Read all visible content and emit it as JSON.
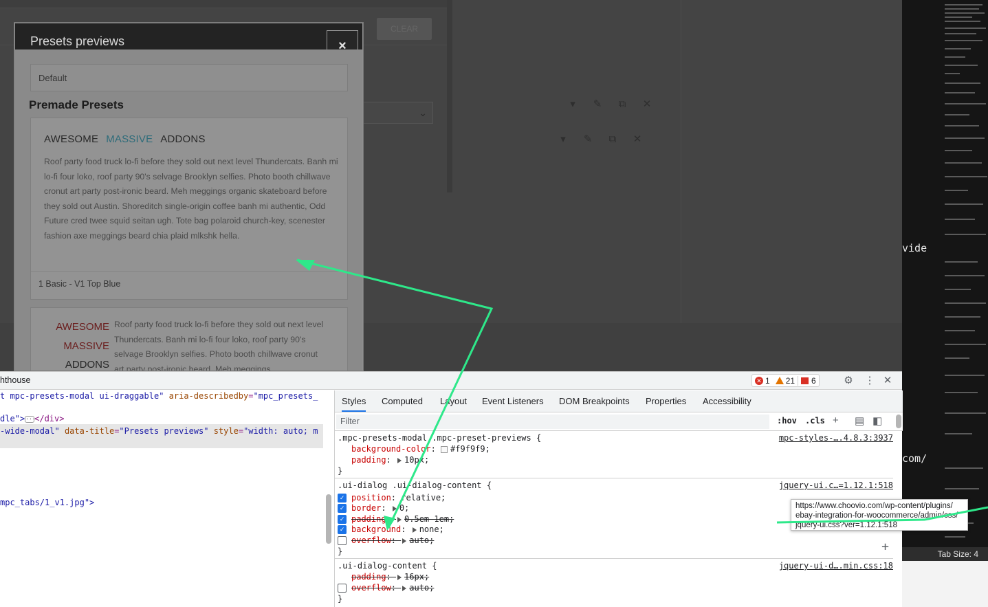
{
  "background_page": {
    "button_label": "CLEAR"
  },
  "modal": {
    "title": "Presets previews",
    "close_label": "×",
    "default_label": "Default",
    "section_title": "Premade Presets",
    "card1": {
      "brand_word1": "AWESOME",
      "brand_word2": "MASSIVE",
      "brand_word3": "ADDONS",
      "paragraph": "Roof party food truck lo-fi before they sold out next level Thundercats. Banh mi lo-fi four loko, roof party 90's selvage Brooklyn selfies. Photo booth chillwave cronut art party post-ironic beard. Meh meggings organic skateboard before they sold out Austin. Shoreditch single-origin coffee banh mi authentic, Odd Future cred twee squid seitan ugh. Tote bag polaroid church-key, scenester fashion axe meggings beard chia plaid mlkshk hella.",
      "caption": "1 Basic - V1 Top Blue"
    },
    "card2": {
      "brand_word1": "AWESOME",
      "brand_word2": "MASSIVE",
      "brand_word3": "ADDONS",
      "paragraph": "Roof party food truck lo-fi before they sold out next level Thundercats. Banh mi lo-fi four loko, roof party 90's selvage Brooklyn selfies. Photo booth chillwave cronut art party post-ironic beard. Meh meggings"
    }
  },
  "editor": {
    "text1": "vide",
    "text2": "com/",
    "status": "Tab Size: 4"
  },
  "devtools": {
    "panel_label": "hthouse",
    "errors": "1",
    "warnings": "21",
    "issues": "6",
    "elements": {
      "line1_prefix": "t mpc-presets-modal ui-draggable\"",
      "line1_attr": "aria-describedby",
      "line1_val": "\"mpc_presets_",
      "line2_prefix": "dle\">",
      "line2_suffix": "</div>",
      "line3_prefix": "-wide-modal\"",
      "line3_attr1": "data-title",
      "line3_val1": "\"Presets previews\"",
      "line3_attr2": "style",
      "line3_val2": "\"width: auto; m",
      "line4": "mpc_tabs/1_v1.jpg\">"
    },
    "tabs": [
      "Styles",
      "Computed",
      "Layout",
      "Event Listeners",
      "DOM Breakpoints",
      "Properties",
      "Accessibility"
    ],
    "filter_placeholder": "Filter",
    "hov": ":hov",
    "cls": ".cls",
    "rules": [
      {
        "selector": ".mpc-presets-modal .mpc-preset-previews {",
        "source": "mpc-styles-….4.8.3:3937",
        "decls": [
          {
            "prop": "background-color",
            "value": "#f9f9f9"
          },
          {
            "prop": "padding",
            "value": "10px"
          }
        ]
      },
      {
        "selector": ".ui-dialog .ui-dialog-content {",
        "source": "jquery-ui.c…=1.12.1:518",
        "decls": [
          {
            "prop": "position",
            "value": "relative"
          },
          {
            "prop": "border",
            "value": "0"
          },
          {
            "prop": "padding",
            "value": "0.5em 1em"
          },
          {
            "prop": "background",
            "value": "none"
          },
          {
            "prop": "overflow",
            "value": "auto"
          }
        ]
      },
      {
        "selector": ".ui-dialog-content {",
        "source": "jquery-ui-d….min.css:18",
        "decls": [
          {
            "prop": "padding",
            "value": "16px"
          },
          {
            "prop": "overflow",
            "value": "auto"
          }
        ]
      }
    ],
    "close_brace": "}",
    "tooltip": {
      "line1": "https://www.choovio.com/wp-content/plugins/",
      "line2": "ebay-integration-for-woocommerce/admin/css/",
      "line3": "jquery-ui.css?ver=1.12.1:518"
    }
  },
  "annotation": {
    "arrow_color": "#2ee88a"
  }
}
